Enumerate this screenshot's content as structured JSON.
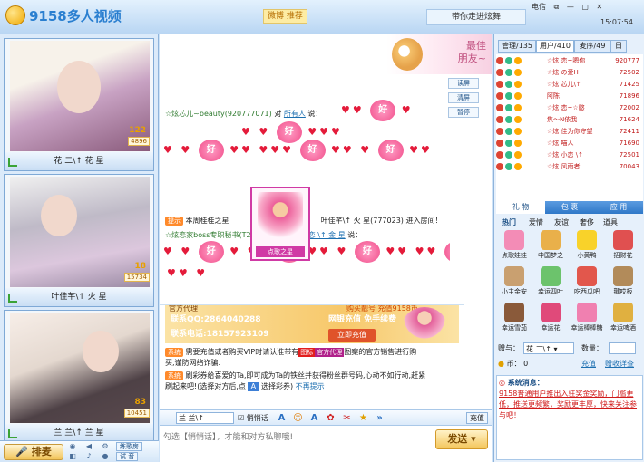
{
  "app": {
    "title": "9158多人视频",
    "recommend": "微博 推荐",
    "tagline": "带你走进炫舞",
    "clock": "15:07:54"
  },
  "window": {
    "telecom": "电信",
    "controls": [
      "⧉",
      "—",
      "▢",
      "✕"
    ]
  },
  "performers": [
    {
      "name": "花 二\\↑ 花 星",
      "level": "122",
      "rank": "4896"
    },
    {
      "name": "叶佳芊\\↑ 火 星",
      "level": "18",
      "rank": "15734"
    },
    {
      "name": "兰 兰\\↑ 兰 星",
      "level": "83",
      "rank": "10451"
    }
  ],
  "mic": {
    "label": "排麦",
    "buttons": [
      "练歌房",
      "试 音"
    ]
  },
  "banner": {
    "line1": "最佳",
    "line2": "朋友~"
  },
  "side_buttons": [
    "读屏",
    "清屏",
    "暂停"
  ],
  "chat": {
    "msg1": {
      "sender": "☆炫芯儿~beauty(920777071)",
      "verb": "对",
      "target": "所有人",
      "suffix": "说："
    },
    "hao": "好",
    "gift_label": "点歌之星",
    "prompt_badge": "提示",
    "entry_text": "本周桂桂之星",
    "entry_user": "叶佳芊\\↑ 火  星(777023) 进入房间！",
    "msg2": {
      "sender": "☆炫恋家boss专职秘书(T20062)",
      "verb": "对",
      "target": "小恋 \\↑ 金 星",
      "suffix": "说："
    }
  },
  "ad": {
    "title": "官方代理",
    "qq": "联系QQ:2864040288",
    "tel": "联系电话:18157923109",
    "tag": "购买靓号 充值9158币",
    "slogan": "网银充值 免手续费",
    "button": "立即充值"
  },
  "system": {
    "badge": "系统",
    "line1": "需要充值或者购买VIP时请认准带有",
    "line1b": "图标",
    "official": "官方代理",
    "line1c": "图案的官方销售进行购",
    "line2": "买,谨防网络诈骗.",
    "line3": "刷彩券给喜爱的Ta,即可成为Ta的铁丝并获得粉丝群号码,心动不如行动,赶紧",
    "line4": "刷起来吧!(选择对方后,点",
    "line4b": "选择彩券)",
    "no_show": "不再提示"
  },
  "toolbar": {
    "target": "兰 兰\\↑",
    "whisper": "悄悄话",
    "recharge": "充值"
  },
  "input": {
    "placeholder": "勾选【悄悄话】，才能和对方私聊哦!",
    "send": "发送"
  },
  "right": {
    "tabs": [
      "管理/135",
      "用户/410",
      "麦序/49",
      "日"
    ],
    "users": [
      {
        "name": "☆炫 恋~嗯你",
        "id": "920777"
      },
      {
        "name": "☆炫 の爱H",
        "id": "72502"
      },
      {
        "name": "☆炫 芯儿\\↑",
        "id": "71425"
      },
      {
        "name": "阿陈",
        "id": "71896"
      },
      {
        "name": "☆炫 恋~☆憨",
        "id": "72002"
      },
      {
        "name": "焦～N依我",
        "id": "71624"
      },
      {
        "name": "☆炫 佳为你守望",
        "id": "72411"
      },
      {
        "name": "☆炫 喵人",
        "id": "71690"
      },
      {
        "name": "☆炫 小恋 \\↑",
        "id": "72501"
      },
      {
        "name": "☆炫 风雨者",
        "id": "70043"
      }
    ],
    "gift_tabs": [
      "礼 物",
      "包 裹",
      "应 用"
    ],
    "gift_cats": [
      "热门",
      "爱情",
      "友谊",
      "奢侈",
      "道具"
    ],
    "gifts": [
      "点歌娃娃",
      "中国梦之",
      "小黄鸭",
      "招财花",
      "小主金安",
      "幸运四叶",
      "吃西瓜吧",
      "毽哎板",
      "幸运雪茄",
      "幸运花",
      "幸运棒棒糖",
      "幸运啤酒"
    ],
    "give_label": "赠与：",
    "give_target": "花 二\\↑",
    "qty_label": "数量：",
    "coins_label": "币：",
    "coins_value": "0",
    "recharge": "充值",
    "detail": "赠收详查",
    "sys_title": "系统消息：",
    "sys_text": "9158普通用户推出入驻奖金奖励，门槛更低，推送更频繁，奖励更丰厚，快来关注参与吧！"
  },
  "colors": {
    "accent": "#2a7fd0",
    "heart": "#e41b3a",
    "highlight": "#c01a1a"
  }
}
